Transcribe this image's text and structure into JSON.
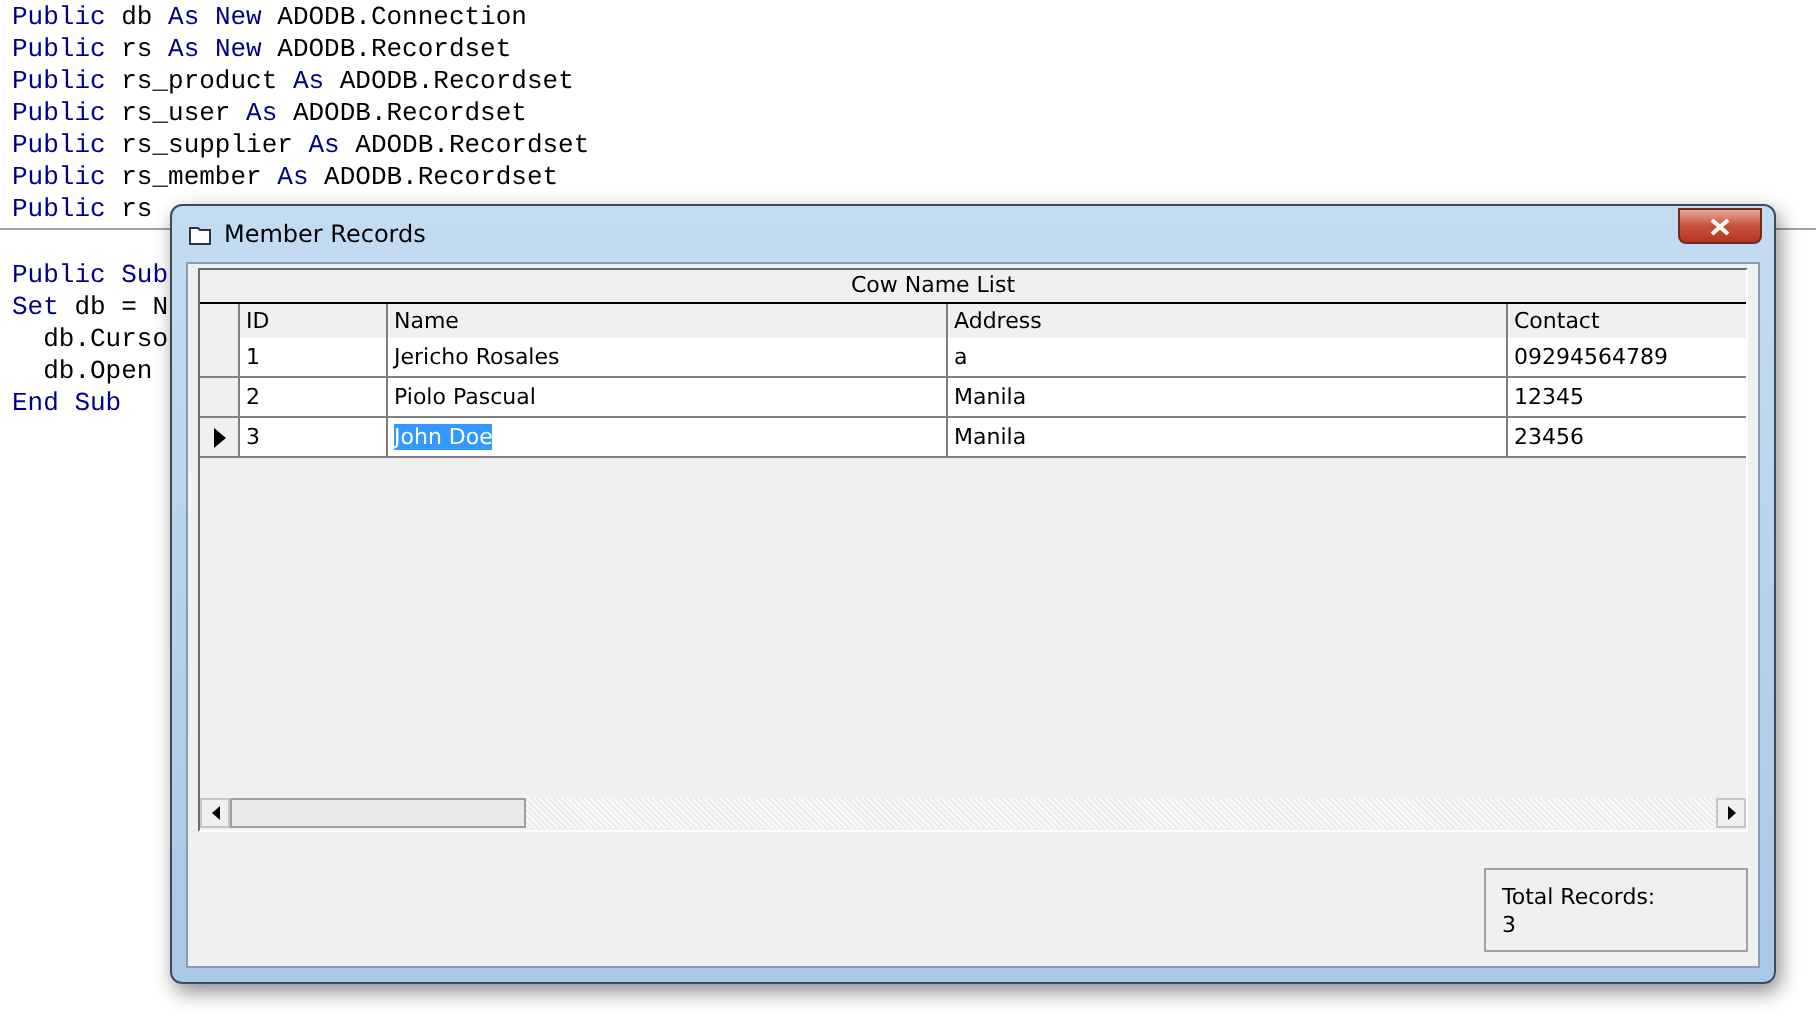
{
  "code_editor": {
    "declarations": [
      [
        {
          "kind": "keyword",
          "text": "Public"
        },
        {
          "kind": "plain",
          "text": " db "
        },
        {
          "kind": "keyword",
          "text": "As "
        },
        {
          "kind": "keyword",
          "text": "New"
        },
        {
          "kind": "plain",
          "text": " ADODB.Connection"
        }
      ],
      [
        {
          "kind": "keyword",
          "text": "Public"
        },
        {
          "kind": "plain",
          "text": " rs "
        },
        {
          "kind": "keyword",
          "text": "As "
        },
        {
          "kind": "keyword",
          "text": "New"
        },
        {
          "kind": "plain",
          "text": " ADODB.Recordset"
        }
      ],
      [
        {
          "kind": "keyword",
          "text": "Public"
        },
        {
          "kind": "plain",
          "text": " rs_product "
        },
        {
          "kind": "keyword",
          "text": "As"
        },
        {
          "kind": "plain",
          "text": " ADODB.Recordset"
        }
      ],
      [
        {
          "kind": "keyword",
          "text": "Public"
        },
        {
          "kind": "plain",
          "text": " rs_user "
        },
        {
          "kind": "keyword",
          "text": "As"
        },
        {
          "kind": "plain",
          "text": " ADODB.Recordset"
        }
      ],
      [
        {
          "kind": "keyword",
          "text": "Public"
        },
        {
          "kind": "plain",
          "text": " rs_supplier "
        },
        {
          "kind": "keyword",
          "text": "As"
        },
        {
          "kind": "plain",
          "text": " ADODB.Recordset"
        }
      ],
      [
        {
          "kind": "keyword",
          "text": "Public"
        },
        {
          "kind": "plain",
          "text": " rs_member "
        },
        {
          "kind": "keyword",
          "text": "As"
        },
        {
          "kind": "plain",
          "text": " ADODB.Recordset"
        }
      ],
      [
        {
          "kind": "keyword",
          "text": "Public"
        },
        {
          "kind": "plain",
          "text": " rs"
        }
      ]
    ],
    "procedure": [
      [
        {
          "kind": "keyword",
          "text": "Public Sub"
        }
      ],
      [
        {
          "kind": "keyword",
          "text": "Set"
        },
        {
          "kind": "plain",
          "text": " db = N"
        }
      ],
      [
        {
          "kind": "plain",
          "text": "  db.Curso"
        }
      ],
      [
        {
          "kind": "plain",
          "text": "  db.Open"
        }
      ],
      [
        {
          "kind": "keyword",
          "text": "End Sub"
        }
      ]
    ]
  },
  "window": {
    "title": "Member Records",
    "grid": {
      "caption": "Cow Name List",
      "columns": [
        "ID",
        "Name",
        "Address",
        "Contact"
      ],
      "rows": [
        {
          "selected": false,
          "cells": [
            "1",
            "Jericho Rosales",
            "a",
            "09294564789"
          ]
        },
        {
          "selected": false,
          "cells": [
            "2",
            "Piolo Pascual",
            "Manila",
            "12345"
          ]
        },
        {
          "selected": true,
          "cells": [
            "3",
            "John Doe",
            "Manila",
            "23456"
          ]
        }
      ]
    },
    "total": {
      "label": "Total Records:",
      "value": "3"
    }
  }
}
